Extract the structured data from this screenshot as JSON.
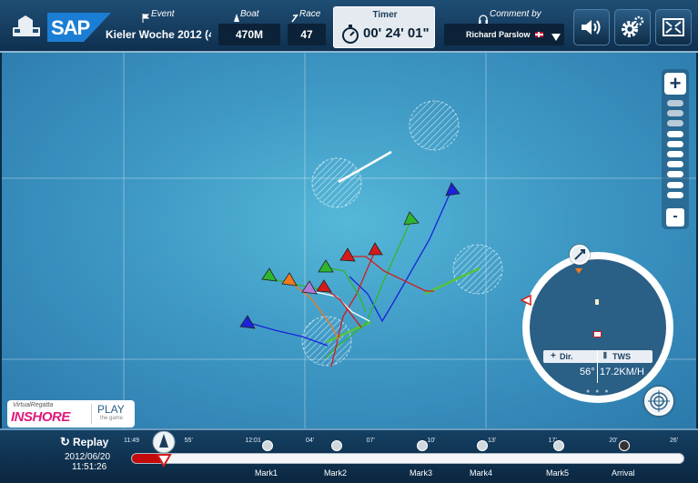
{
  "topbar": {
    "logo_text": "SAP",
    "event_label": "Event",
    "event_value": "Kieler Woche 2012 (4'",
    "boat_label": "Boat",
    "boat_value": "470M",
    "race_label": "Race",
    "race_value": "47",
    "timer_label": "Timer",
    "timer_value": "00' 24' 01\"",
    "comment_label": "Comment by",
    "comment_value": "Richard Parslow"
  },
  "zoom": {
    "plus": "+",
    "minus": "-",
    "level_steps": 10,
    "active_steps": 7
  },
  "compass": {
    "dir_label": "Dir.",
    "tws_label": "TWS",
    "dir_value": "56°",
    "tws_value": "17.2KM/H"
  },
  "promo": {
    "brand_top": "VirtualRegatta",
    "brand_main": "inshore",
    "play": "PLAY",
    "play_sub": "the game"
  },
  "replay": {
    "label": "Replay",
    "date": "2012/06/20",
    "time": "11:51:26",
    "progress": 0.06,
    "ticks": [
      "11:49",
      "55'",
      "12:01",
      "04'",
      "07'",
      "10'",
      "13'",
      "17'",
      "20'",
      "26'"
    ],
    "marks": [
      "Mark1",
      "Mark2",
      "Mark3",
      "Mark4",
      "Mark5",
      "Arrival"
    ]
  },
  "colors": {
    "blue": "#1a23d8",
    "green": "#2fb62f",
    "red": "#d61a1a",
    "orange": "#f07a1f",
    "purple": "#b07ad8",
    "white": "#ffffff",
    "lime": "#7ed43c",
    "red_dark": "#c40a0a"
  }
}
